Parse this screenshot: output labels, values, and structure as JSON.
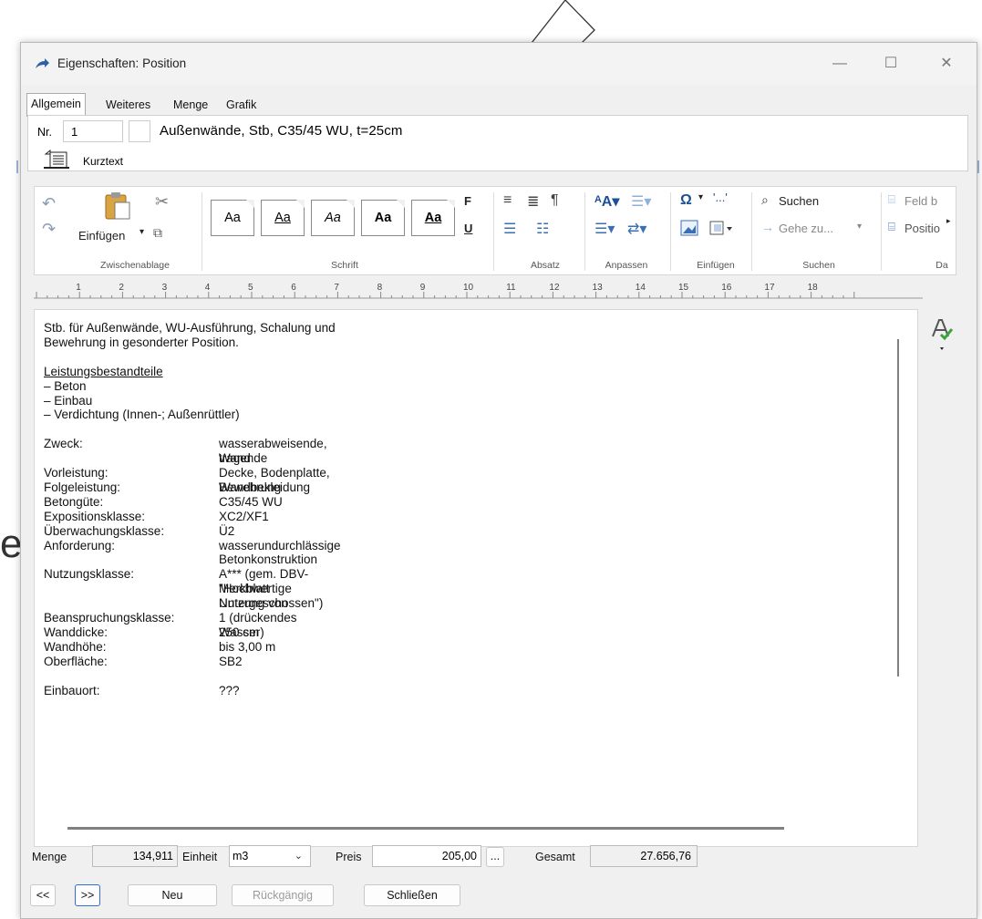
{
  "window": {
    "title": "Eigenschaften: Position",
    "minimize": "—",
    "maximize": "☐",
    "close": "✕"
  },
  "tabs": [
    "Allgemein",
    "Weiteres",
    "Menge",
    "Grafik"
  ],
  "header": {
    "nr_label": "Nr.",
    "nr_value": "1",
    "short_text": "Außenwände, Stb, C35/45 WU, t=25cm",
    "kurztext_label": "Kurztext"
  },
  "ribbon": {
    "clipboard": {
      "paste": "Einfügen",
      "group": "Zwischenablage"
    },
    "font": {
      "styles": [
        "Aa",
        "Aa",
        "Aa",
        "Aa",
        "Aa"
      ],
      "bold": "F",
      "underline": "U",
      "group": "Schrift"
    },
    "paragraph": {
      "group": "Absatz"
    },
    "adjust": {
      "group": "Anpassen"
    },
    "insert": {
      "group": "Einfügen",
      "symbol": "Ω",
      "dots": "'...'"
    },
    "search": {
      "find": "Suchen",
      "goto": "Gehe zu...",
      "group": "Suchen"
    },
    "data": {
      "field": "Feld b",
      "position": "Positio",
      "group": "Da"
    }
  },
  "ruler": [
    "1",
    "2",
    "3",
    "4",
    "5",
    "6",
    "7",
    "8",
    "9",
    "10",
    "11",
    "12",
    "13",
    "14",
    "15",
    "16",
    "17",
    "18"
  ],
  "document": {
    "intro_1": "Stb. für Außenwände, WU-Ausführung, Schalung und",
    "intro_2": "Bewehrung in gesonderter Position.",
    "section_heading": "Leistungsbestandteile",
    "items": [
      "–  Beton",
      "–  Einbau",
      "–  Verdichtung (Innen-; Außenrüttler)"
    ],
    "props": [
      {
        "label": "Zweck:",
        "value": [
          "wasserabweisende, tragende",
          "Wand"
        ]
      },
      {
        "label": "Vorleistung:",
        "value": [
          "Decke, Bodenplatte, Bewehrung"
        ]
      },
      {
        "label": "Folgeleistung:",
        "value": [
          "Wandbekleidung"
        ]
      },
      {
        "label": "Betongüte:",
        "value": [
          "C35/45 WU"
        ]
      },
      {
        "label": "Expositionsklasse:",
        "value": [
          "XC2/XF1"
        ]
      },
      {
        "label": "Überwachungsklasse:",
        "value": [
          "Ü2"
        ]
      },
      {
        "label": "Anforderung:",
        "value": [
          "wasserundurchlässige",
          "Betonkonstruktion"
        ]
      },
      {
        "label": "Nutzungsklasse:",
        "value": [
          "A*** (gem. DBV-Merkblatt",
          "\"Hochwertige Nutzung von",
          "Untergeschossen\")"
        ]
      },
      {
        "label": "Beanspruchungsklasse:",
        "value": [
          "1 (drückendes Wasser)"
        ]
      },
      {
        "label": "Wanddicke:",
        "value": [
          "250 cm"
        ]
      },
      {
        "label": "Wandhöhe:",
        "value": [
          "bis 3,00 m"
        ]
      },
      {
        "label": "Oberfläche:",
        "value": [
          "SB2"
        ]
      }
    ],
    "einbauort_label": "Einbauort:",
    "einbauort_value": "???"
  },
  "bottom": {
    "menge_label": "Menge",
    "menge_value": "134,911",
    "einheit_label": "Einheit",
    "einheit_value": "m3",
    "preis_label": "Preis",
    "preis_value": "205,00",
    "ellipsis": "...",
    "gesamt_label": "Gesamt",
    "gesamt_value": "27.656,76"
  },
  "buttons": {
    "prev": "<<",
    "next": ">>",
    "neu": "Neu",
    "rueckgaengig": "Rückgängig",
    "schliessen": "Schließen"
  },
  "background": {
    "letter": "e"
  },
  "colors": {
    "accent": "#2e6fd1",
    "icon_blue": "#3a6fb5",
    "spell_green": "#3aa43a"
  }
}
